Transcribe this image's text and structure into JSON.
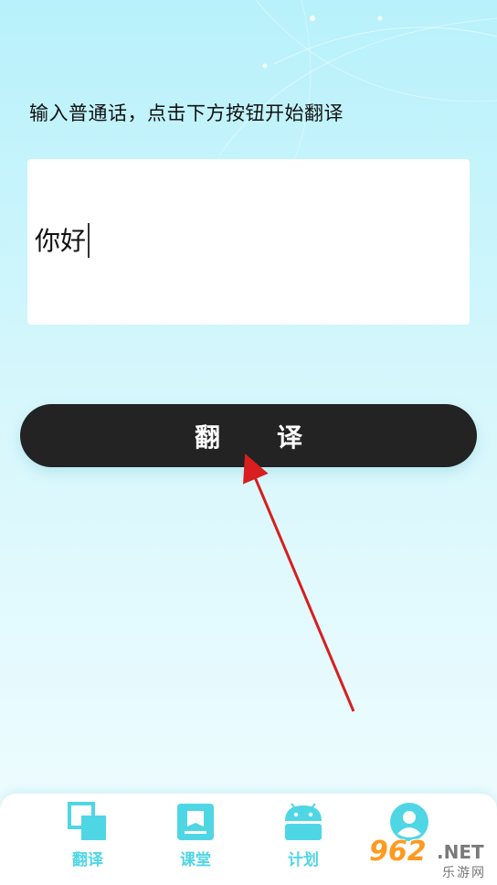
{
  "instruction": "输入普通话，点击下方按钮开始翻译",
  "input": {
    "value": "你好"
  },
  "translate_button": {
    "label": "翻译"
  },
  "bottom_nav": {
    "items": [
      {
        "label": "翻译",
        "icon": "translate-icon"
      },
      {
        "label": "课堂",
        "icon": "book-icon"
      },
      {
        "label": "计划",
        "icon": "android-icon"
      },
      {
        "label": "",
        "icon": "user-icon"
      }
    ]
  },
  "watermark": {
    "number": "962",
    "domain": ".NET",
    "site": "乐游网"
  },
  "colors": {
    "accent": "#4fd6e5",
    "button_bg": "#232323",
    "arrow": "#d81e1e"
  }
}
